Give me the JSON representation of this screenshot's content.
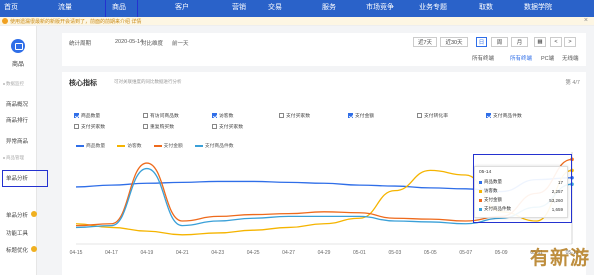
{
  "topnav": {
    "items": [
      "首页",
      "流量",
      "商品",
      "客户",
      "营销",
      "交易",
      "服务",
      "市场竞争",
      "业务专题",
      "取数",
      "数据学院"
    ]
  },
  "notice": {
    "text": "使用遗漏很最新的新版开会请到了，前面的前期来介绍 详情",
    "close": "×"
  },
  "sidebar": {
    "head_label": "商品",
    "groups": [
      {
        "group": "数据监控",
        "items": [
          "商品概况",
          "商品排行",
          "异常商品"
        ]
      },
      {
        "group": "商品管理",
        "items": [
          "单品分析",
          "单品分析",
          "功能工具",
          "标题优化"
        ]
      }
    ],
    "badges": [
      "",
      ""
    ]
  },
  "filterbar": {
    "date_label": "统计周期",
    "date_value": "2020-05-14",
    "compare_label": "对比维度",
    "compare_value": "前一天",
    "range_buttons": [
      "近7天",
      "近30天",
      "日",
      "周",
      "月"
    ],
    "selected_range": "日",
    "calendar_icon": "calendar-icon",
    "prev": "<",
    "next": ">",
    "terminal_label": "所有终端",
    "terminal_options": [
      "所有终端",
      "PC端",
      "无线端"
    ],
    "all_label": "所有终端"
  },
  "card": {
    "title": "核心指标",
    "subtitle": "可对关联维度的同比数据进行分析",
    "pager": "第 4/7",
    "metrics": [
      {
        "label": "商品数量",
        "checked": true
      },
      {
        "label": "有访问商品数",
        "checked": false
      },
      {
        "label": "访客数",
        "checked": true
      },
      {
        "label": "支付买家数",
        "checked": false
      },
      {
        "label": "支付金额",
        "checked": true
      },
      {
        "label": "支付转化率",
        "checked": false
      },
      {
        "label": "支付商品件数",
        "checked": true
      },
      {
        "label": "支付买家数",
        "checked": false
      },
      {
        "label": "重复购买数",
        "checked": false
      },
      {
        "label": "支付买家数",
        "checked": false
      }
    ]
  },
  "tooltip": {
    "date": "05-14",
    "rows": [
      {
        "name": "商品数量",
        "value": "17",
        "color": "#2f6ee8"
      },
      {
        "name": "访客数",
        "value": "2,257",
        "color": "#f5b400"
      },
      {
        "name": "支付金额",
        "value": "53,260",
        "color": "#ee6a1c"
      },
      {
        "name": "支付商品件数",
        "value": "1,659",
        "color": "#3aa0d8"
      }
    ]
  },
  "chart_data": {
    "type": "line",
    "categories": [
      "04-15",
      "04-17",
      "04-19",
      "04-21",
      "04-23",
      "04-25",
      "04-27",
      "04-29",
      "05-01",
      "05-03",
      "05-05",
      "05-07",
      "05-09",
      "05-11",
      "05-13"
    ],
    "series": [
      {
        "name": "商品数量",
        "color": "#2f6ee8",
        "values": [
          62,
          64,
          66,
          67,
          68,
          68,
          67,
          66,
          64,
          63,
          61,
          60,
          57,
          70,
          72
        ]
      },
      {
        "name": "访客数",
        "color": "#f5b400",
        "values": [
          22,
          18,
          14,
          10,
          12,
          15,
          18,
          22,
          28,
          58,
          80,
          75,
          35,
          25,
          80
        ]
      },
      {
        "name": "支付金额",
        "color": "#ee6a1c",
        "values": [
          20,
          22,
          88,
          25,
          30,
          32,
          33,
          35,
          34,
          28,
          27,
          25,
          30,
          55,
          92
        ]
      },
      {
        "name": "支付商品件数",
        "color": "#3aa0d8",
        "values": [
          18,
          20,
          82,
          20,
          25,
          28,
          30,
          30,
          30,
          25,
          24,
          22,
          28,
          40,
          65
        ]
      }
    ],
    "legend": [
      "商品数量",
      "访客数",
      "支付金额",
      "支付商品件数"
    ],
    "ylim": [
      0,
      100
    ]
  },
  "watermark": "有新游"
}
